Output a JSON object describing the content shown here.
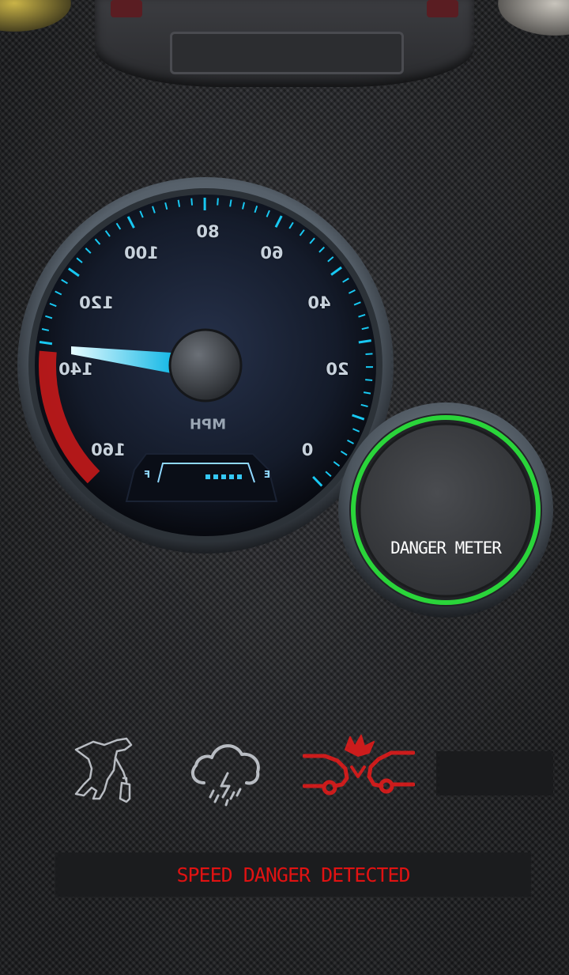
{
  "speedometer": {
    "unit": "MPH",
    "scale_labels": [
      "0",
      "20",
      "40",
      "60",
      "80",
      "100",
      "120",
      "140",
      "160"
    ],
    "current_speed_mph": 142,
    "fuel": {
      "full_label": "F",
      "empty_label": "E"
    },
    "accent_color": "#18c8f2",
    "danger_zone_color": "#d01a1a"
  },
  "danger_meter": {
    "label": "DANGER METER",
    "ring_color": "#2ad53a"
  },
  "hazards": [
    {
      "icon": "drunk-driver-icon",
      "active": false
    },
    {
      "icon": "storm-cloud-icon",
      "active": false
    },
    {
      "icon": "car-collision-icon",
      "active": true,
      "color": "#cc1c1c"
    }
  ],
  "status": {
    "message": "SPEED DANGER DETECTED",
    "color": "#e01212"
  }
}
